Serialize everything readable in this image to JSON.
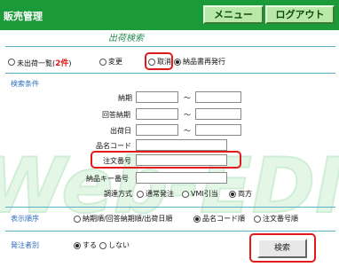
{
  "header": {
    "app_title": "販売管理",
    "menu_label": "メニュー",
    "logout_label": "ログアウト"
  },
  "section_title": "出荷検索",
  "list_type": {
    "options": [
      {
        "label": "未出荷一覧(",
        "count": "2件",
        "suffix": ")",
        "selected": false
      },
      {
        "label": "変更",
        "selected": false
      },
      {
        "label": "取消",
        "selected": false
      },
      {
        "label": "納品書再発行",
        "selected": true
      }
    ]
  },
  "search_conditions": {
    "heading": "検索条件",
    "range_sep": "～",
    "fields": {
      "delivery_date": "納期",
      "reply_delivery_date": "回答納期",
      "ship_date": "出荷日",
      "product_code": "品名コード",
      "order_number": "注文番号",
      "product_key_number": "納品キー番号",
      "procurement_method": "調達方式"
    },
    "procurement_options": [
      {
        "label": "通常発注",
        "selected": false
      },
      {
        "label": "VMI引当",
        "selected": false
      },
      {
        "label": "両方",
        "selected": true
      }
    ]
  },
  "display_order": {
    "label": "表示順序",
    "options": [
      {
        "label": "納期順/回答納期順/出荷日順",
        "selected": false
      },
      {
        "label": "品名コード順",
        "selected": true
      },
      {
        "label": "注文番号順",
        "selected": false
      }
    ]
  },
  "orderer_flag": {
    "label": "発注者別",
    "options": [
      {
        "label": "する",
        "selected": true
      },
      {
        "label": "しない",
        "selected": false
      }
    ]
  },
  "search_button": "検索",
  "watermark": "Web-EDI",
  "colors": {
    "header_bg": "#1b9a3a",
    "accent_blue": "#2f6fbe",
    "highlight_red": "#e11b1b"
  }
}
